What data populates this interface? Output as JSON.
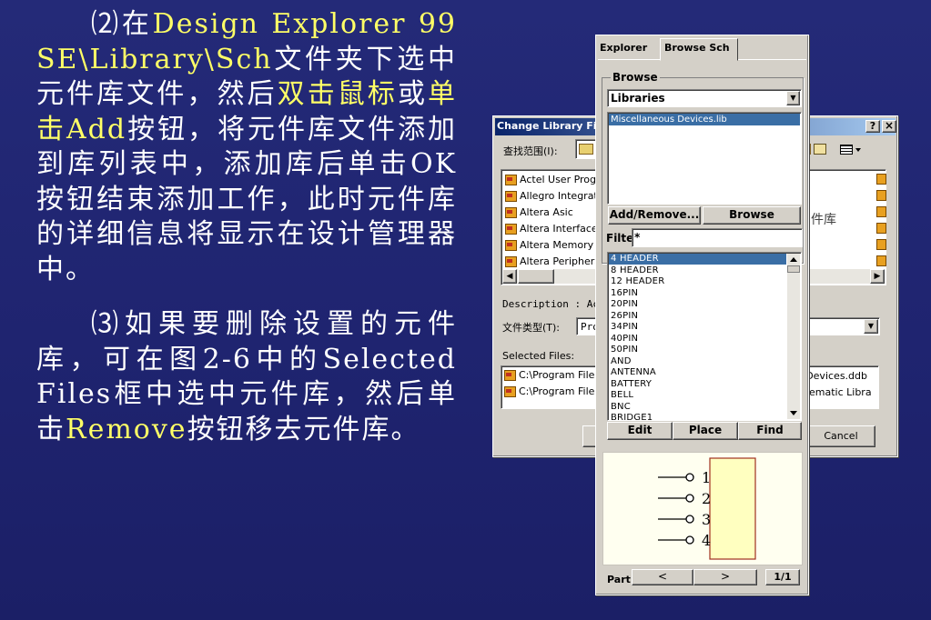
{
  "slide": {
    "p1": {
      "a": "⑵在",
      "b": "Design Explorer 99 SE\\Library\\Sch",
      "c": "文件夹下选中元件库文件，然后",
      "d": "双击鼠标",
      "e": "或",
      "f": "单击Add",
      "g": "按钮，将元件库文件添加到库列表中，添加库后单击OK按钮结束添加工作，此时元件库的详细信息将显示在设计管理器中。"
    },
    "p2": {
      "a": "⑶如果要删除设置的元件库，可在图2-6中的Selected Files框中选中元件库，然后单击",
      "b": "Remove",
      "c": "按钮移去元件库。"
    }
  },
  "change_library": {
    "title": "Change Library File",
    "help": "?",
    "close": "×",
    "look_in_label": "查找范围(I):",
    "right_label_fragment": "件库",
    "libraries": [
      "Actel User Progra",
      "Allegro Integrated",
      "Altera Asic",
      "Altera Interface",
      "Altera Memory",
      "Altera Peripheral"
    ],
    "description_label": "Description : Act",
    "file_type_label": "文件类型(T):",
    "file_type_value": "Pro",
    "selected_files_label": "Selected Files:",
    "selected_files": [
      "C:\\Program Files\\",
      "C:\\Program Files\\"
    ],
    "selected_right": [
      "us Devices.ddb",
      "Schematic Libra"
    ],
    "cancel": "Cancel"
  },
  "browse_panel": {
    "tabs": [
      "Explorer",
      "Browse Sch"
    ],
    "browse_group": "Browse",
    "browse_select": "Libraries",
    "library_list": [
      "Miscellaneous Devices.lib"
    ],
    "add_remove": "Add/Remove...",
    "browse_btn": "Browse",
    "filter_label": "Filte",
    "filter_value": "*",
    "components": [
      "4 HEADER",
      "8 HEADER",
      "12 HEADER",
      "16PIN",
      "20PIN",
      "26PIN",
      "34PIN",
      "40PIN",
      "50PIN",
      "AND",
      "ANTENNA",
      "BATTERY",
      "BELL",
      "BNC",
      "BRIDGE1"
    ],
    "edit": "Edit",
    "place": "Place",
    "find": "Find",
    "pins": [
      "1",
      "2",
      "3",
      "4"
    ],
    "part_label": "Part",
    "prev": "<",
    "next": ">",
    "page": "1/1"
  }
}
